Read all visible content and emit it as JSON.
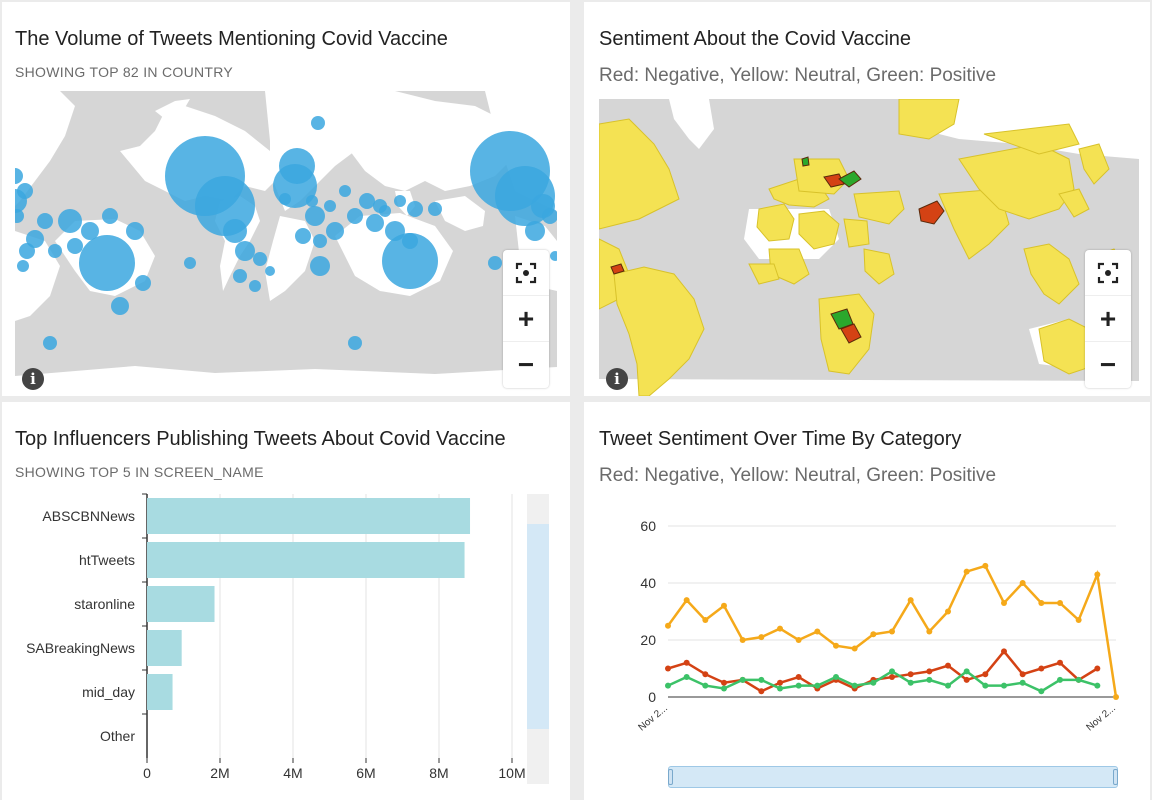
{
  "panels": {
    "volume": {
      "title": "The Volume of Tweets Mentioning Covid Vaccine",
      "subtitle": "SHOWING TOP 82 IN COUNTRY",
      "bubble_color": "#3ba7df"
    },
    "sentiment_map": {
      "title": "Sentiment About the Covid Vaccine",
      "subtitle": "Red: Negative, Yellow: Neutral, Green: Positive",
      "colors": {
        "negative": "#d44214",
        "neutral": "#f4e253",
        "positive": "#2ba82c"
      }
    },
    "influencers": {
      "title": "Top Influencers Publishing Tweets About Covid Vaccine",
      "subtitle": "SHOWING TOP 5 IN SCREEN_NAME"
    },
    "sentiment_time": {
      "title": "Tweet Sentiment Over Time By Category",
      "subtitle": "Red: Negative, Yellow: Neutral, Green: Positive"
    }
  },
  "map_controls": {
    "fit_icon": "fit-bounds-icon",
    "zoom_in": "+",
    "zoom_out": "−",
    "info": "i"
  },
  "chart_data": [
    {
      "type": "bar",
      "orientation": "horizontal",
      "categories": [
        "ABSCBNNews",
        "htTweets",
        "staronline",
        "SABreakingNews",
        "mid_day",
        "Other"
      ],
      "values": [
        8850000,
        8700000,
        1850000,
        950000,
        700000,
        0
      ],
      "xlim": [
        0,
        10000000
      ],
      "xticks": [
        "0",
        "2M",
        "4M",
        "6M",
        "8M",
        "10M"
      ],
      "xtick_values": [
        0,
        2000000,
        4000000,
        6000000,
        8000000,
        10000000
      ],
      "bar_color": "#a8dbe1",
      "grid": true
    },
    {
      "type": "line",
      "x_labels": [
        "Nov 2...",
        "Nov 2..."
      ],
      "yticks": [
        0,
        20,
        40,
        60
      ],
      "ylim": [
        0,
        62
      ],
      "grid": true,
      "series": [
        {
          "color": "#f5a91a",
          "values": [
            25,
            34,
            27,
            32,
            20,
            21,
            24,
            20,
            23,
            18,
            17,
            22,
            23,
            34,
            23,
            30,
            44,
            46,
            33,
            40,
            33,
            33,
            27,
            43,
            0
          ]
        },
        {
          "color": "#d44214",
          "values": [
            10,
            12,
            8,
            5,
            6,
            2,
            5,
            7,
            3,
            6,
            3,
            6,
            7,
            8,
            9,
            11,
            6,
            8,
            16,
            8,
            10,
            12,
            6,
            10
          ]
        },
        {
          "color": "#3cc268",
          "values": [
            4,
            7,
            4,
            3,
            6,
            6,
            3,
            4,
            4,
            7,
            4,
            5,
            9,
            5,
            6,
            4,
            9,
            4,
            4,
            5,
            2,
            6,
            6,
            4
          ]
        }
      ]
    }
  ]
}
